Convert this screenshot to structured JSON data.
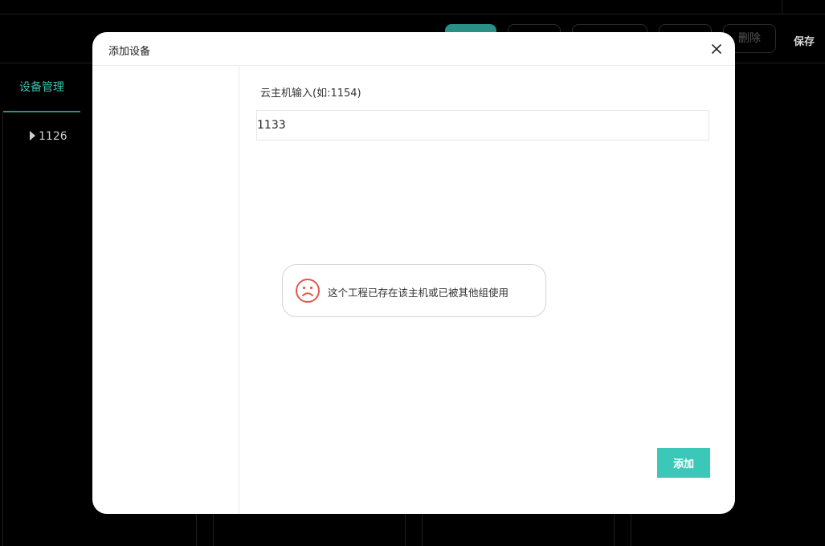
{
  "background": {
    "toolbar": {
      "delete_label": "删除",
      "save_label": "保存"
    },
    "sidebar": {
      "tab_label": "设备管理",
      "tree_item_label": "1126"
    }
  },
  "modal": {
    "title": "添加设备",
    "field_label": "云主机输入(如:1154)",
    "field_value": "1133",
    "add_button_label": "添加"
  },
  "toast": {
    "message": "这个工程已存在该主机或已被其他组使用",
    "icon": "sad-face-icon"
  },
  "colors": {
    "accent": "#3bc8b8",
    "error": "#e05a4f"
  }
}
